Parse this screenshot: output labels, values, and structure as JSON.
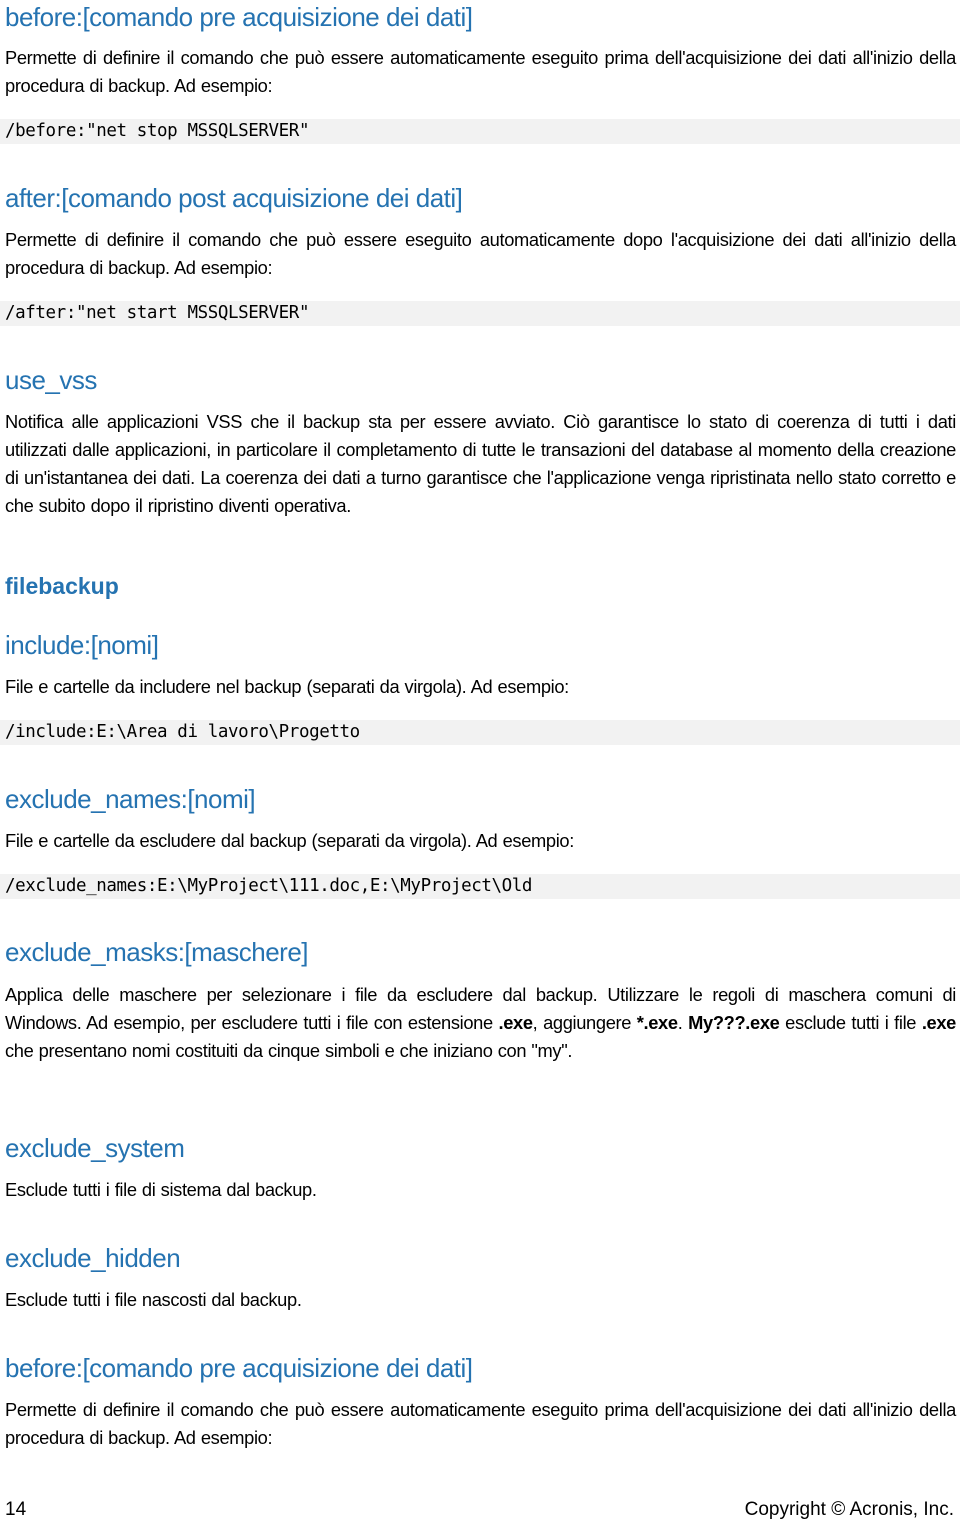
{
  "sections": [
    {
      "heading": "before:[comando pre acquisizione dei dati]",
      "description": "Permette di definire il comando che può essere automaticamente eseguito prima dell'acquisizione dei dati all'inizio della procedura di backup. Ad esempio:",
      "example": "/before:\"net stop MSSQLSERVER\""
    },
    {
      "heading": "after:[comando post acquisizione dei dati]",
      "description": "Permette di definire il comando che può essere eseguito automaticamente dopo l'acquisizione dei dati all'inizio della procedura di backup. Ad esempio:",
      "example": "/after:\"net start MSSQLSERVER\""
    },
    {
      "heading": "use_vss",
      "description": "Notifica alle applicazioni VSS che il backup sta per essere avviato. Ciò garantisce lo stato di coerenza di tutti i dati utilizzati dalle applicazioni, in particolare il completamento di tutte le transazioni del database al momento della creazione di un'istantanea dei dati. La coerenza dei dati a turno garantisce che l'applicazione venga ripristinata nello stato corretto e che subito dopo il ripristino diventi operativa."
    }
  ],
  "group_heading": "filebackup",
  "filebackup_sections": [
    {
      "heading": "include:[nomi]",
      "description": "File e cartelle da includere nel backup (separati da virgola). Ad esempio:",
      "example": "/include:E:\\Area di lavoro\\Progetto"
    },
    {
      "heading": "exclude_names:[nomi]",
      "description": "File e cartelle da escludere dal backup (separati da virgola). Ad esempio:",
      "example": "/exclude_names:E:\\MyProject\\111.doc,E:\\MyProject\\Old"
    },
    {
      "heading": "exclude_masks:[maschere]",
      "description_parts": {
        "p1": "Applica delle maschere per selezionare i file da escludere dal backup. Utilizzare le regoli di maschera comuni di Windows. Ad esempio, per escludere tutti i file con estensione ",
        "b1": ".exe",
        "p2": ", aggiungere ",
        "b2": "*.exe",
        "p3": ". ",
        "b3": "My???.exe",
        "p4": " esclude tutti i file ",
        "b4": ".exe",
        "p5": " che presentano nomi costituiti da cinque simboli e che iniziano con \"my\"."
      }
    },
    {
      "heading": "exclude_system",
      "description": "Esclude tutti i file di sistema dal backup."
    },
    {
      "heading": "exclude_hidden",
      "description": "Esclude tutti i file nascosti dal backup."
    },
    {
      "heading": "before:[comando pre acquisizione dei dati]",
      "description": "Permette di definire il comando che può essere automaticamente eseguito prima dell'acquisizione dei dati all'inizio della procedura di backup. Ad esempio:"
    }
  ],
  "footer": {
    "page_number": "14",
    "copyright": "Copyright © Acronis, Inc."
  }
}
